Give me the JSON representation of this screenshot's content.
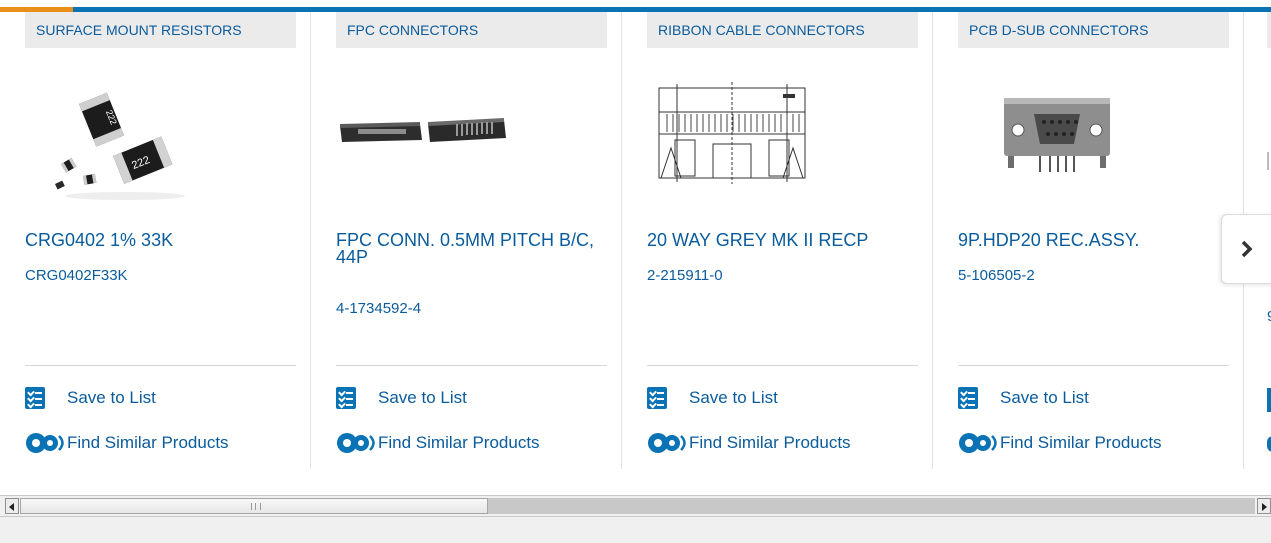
{
  "products": [
    {
      "category": "SURFACE MOUNT RESISTORS",
      "name": "CRG0402 1% 33K",
      "part_number": "CRG0402F33K",
      "save_label": "Save to List",
      "similar_label": "Find Similar Products",
      "resistor_marking": "222"
    },
    {
      "category": "FPC CONNECTORS",
      "name": "FPC CONN. 0.5MM PITCH B/C, 44P",
      "part_number": "4-1734592-4",
      "save_label": "Save to List",
      "similar_label": "Find Similar Products"
    },
    {
      "category": "RIBBON CABLE CONNECTORS",
      "name": "20 WAY GREY MK II RECP",
      "part_number": "2-215911-0",
      "save_label": "Save to List",
      "similar_label": "Find Similar Products"
    },
    {
      "category": "PCB D-SUB CONNECTORS",
      "name": "9P.HDP20 REC.ASSY.",
      "part_number": "5-106505-2",
      "save_label": "Save to List",
      "similar_label": "Find Similar Products"
    }
  ],
  "partial_card": {
    "name_fragment": "9"
  },
  "icons": {
    "save": "list-check-icon",
    "similar": "gears-icon",
    "next": "chevron-right-icon"
  },
  "colors": {
    "link": "#0a5b9c",
    "brand_blue": "#0a73b5",
    "accent_orange": "#e8901a",
    "category_bg": "#ebebeb"
  },
  "scrollbar": {
    "position_fraction": 0.0,
    "visible_fraction": 0.38
  }
}
